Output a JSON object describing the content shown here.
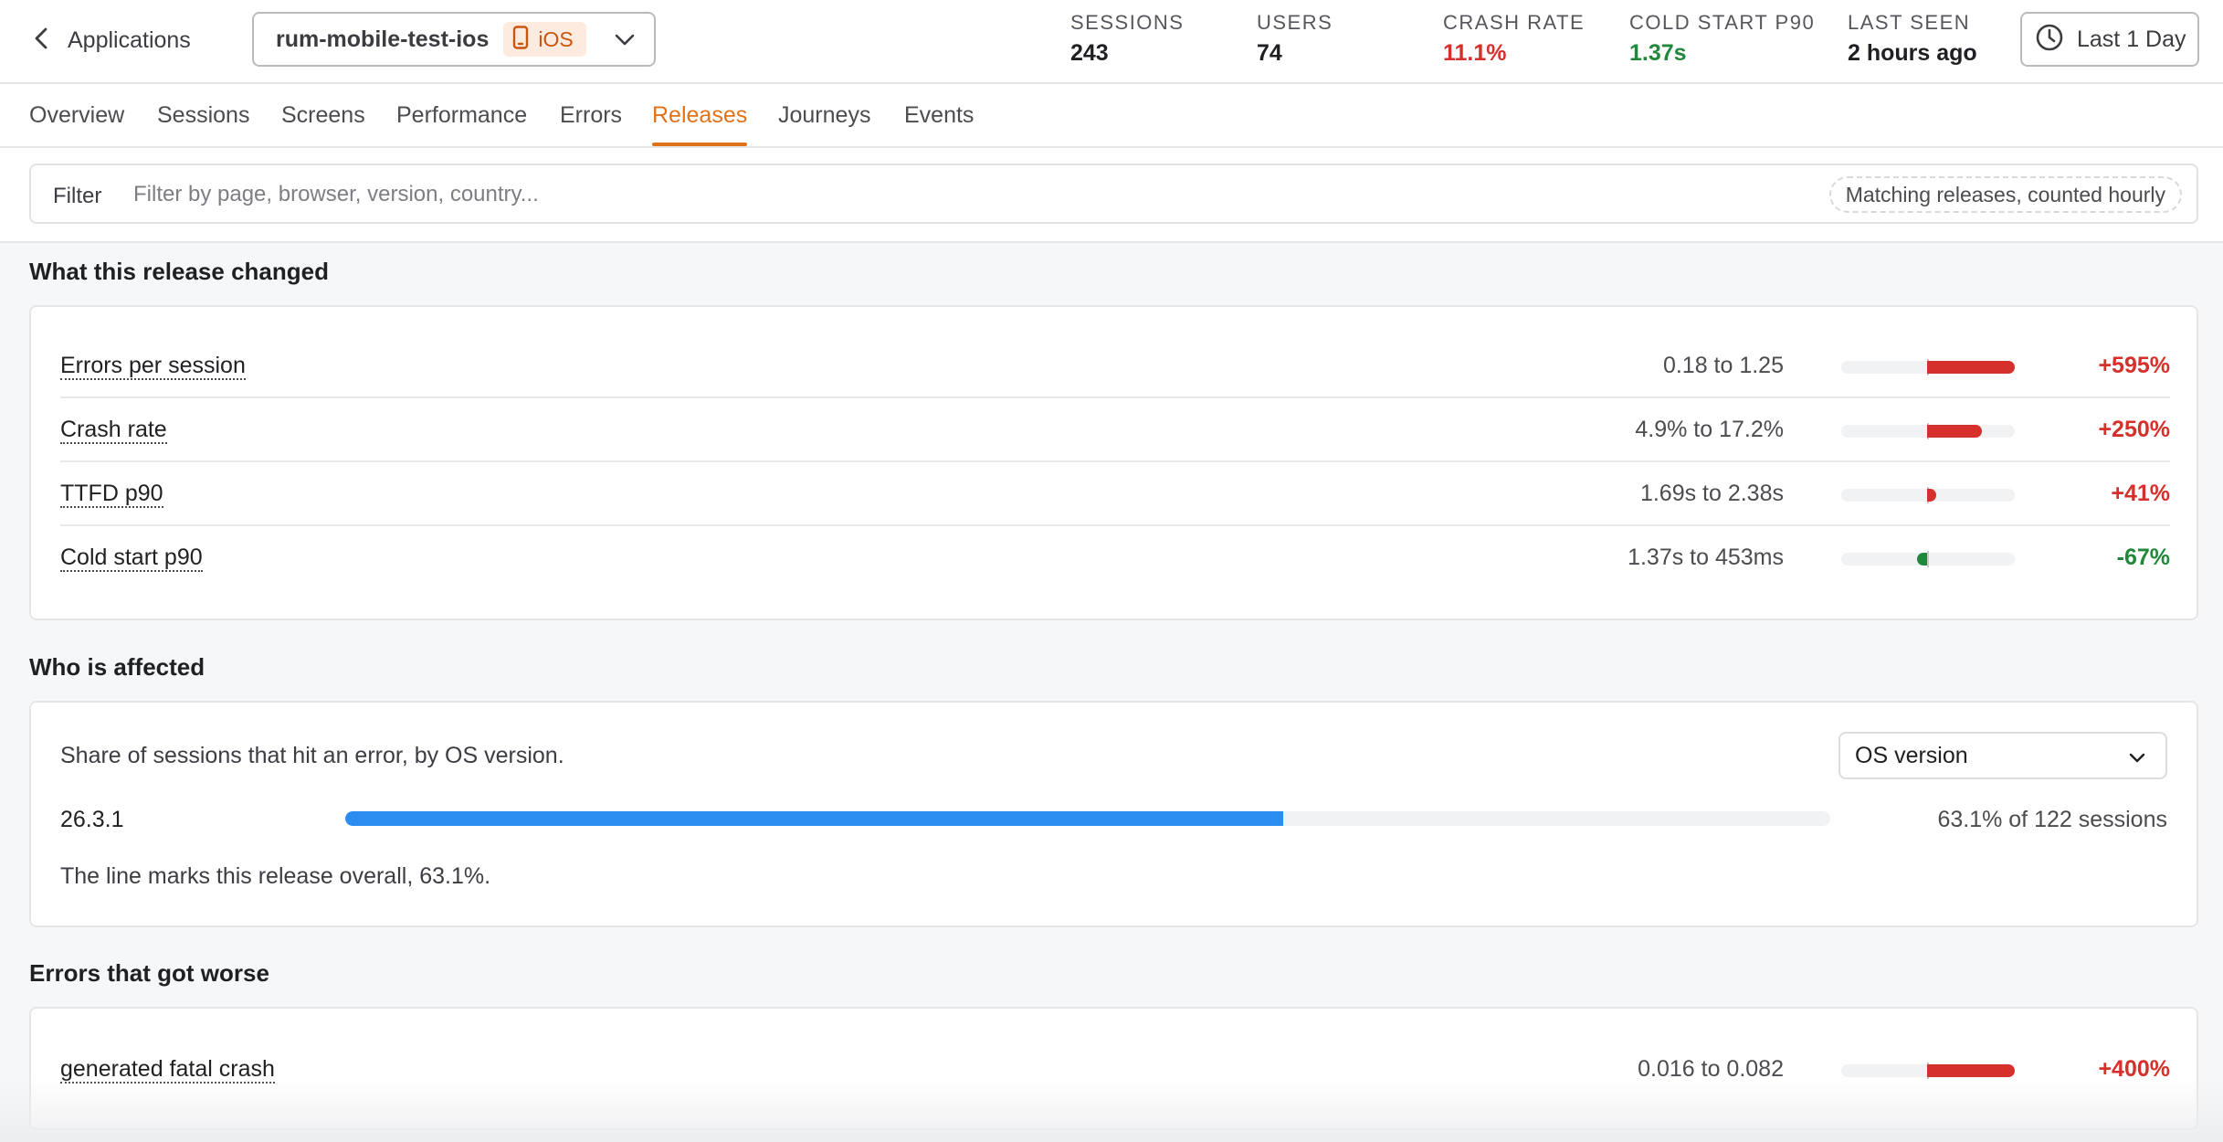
{
  "nav": {
    "back_label": "Applications"
  },
  "app": {
    "name": "rum-mobile-test-ios",
    "platform": "iOS"
  },
  "stats": [
    {
      "key": "SESSIONS",
      "value": "243",
      "tone": ""
    },
    {
      "key": "USERS",
      "value": "74",
      "tone": ""
    },
    {
      "key": "CRASH RATE",
      "value": "11.1%",
      "tone": "red"
    },
    {
      "key": "COLD START P90",
      "value": "1.37s",
      "tone": "green"
    },
    {
      "key": "LAST SEEN",
      "value": "2 hours ago",
      "tone": ""
    }
  ],
  "time_range": {
    "label": "Last 1 Day"
  },
  "tabs": [
    {
      "label": "Overview",
      "active": false
    },
    {
      "label": "Sessions",
      "active": false
    },
    {
      "label": "Screens",
      "active": false
    },
    {
      "label": "Performance",
      "active": false
    },
    {
      "label": "Errors",
      "active": false
    },
    {
      "label": "Releases",
      "active": true
    },
    {
      "label": "Journeys",
      "active": false
    },
    {
      "label": "Events",
      "active": false
    }
  ],
  "filter": {
    "label": "Filter",
    "placeholder": "Filter by page, browser, version, country...",
    "pill": "Matching releases, counted hourly"
  },
  "release_changes": {
    "title": "What this release changed",
    "metrics": [
      {
        "name": "Errors per session",
        "range": "0.18 to 1.25",
        "delta": "+595%",
        "change_pct": 595,
        "direction": "up"
      },
      {
        "name": "Crash rate",
        "range": "4.9% to 17.2%",
        "delta": "+250%",
        "change_pct": 250,
        "direction": "up"
      },
      {
        "name": "TTFD p90",
        "range": "1.69s to 2.38s",
        "delta": "+41%",
        "change_pct": 41,
        "direction": "up"
      },
      {
        "name": "Cold start p90",
        "range": "1.37s to 453ms",
        "delta": "-67%",
        "change_pct": -67,
        "direction": "down"
      }
    ]
  },
  "affected": {
    "title": "Who is affected",
    "description": "Share of sessions that hit an error, by OS version.",
    "group_by": "OS version",
    "rows": [
      {
        "os_version": "26.3.1",
        "share_pct": 63.1,
        "summary": "63.1% of 122 sessions"
      }
    ],
    "overall_pct": 63.1,
    "note": "The line marks this release overall, 63.1%."
  },
  "errors_worse": {
    "title": "Errors that got worse",
    "items": [
      {
        "name": "generated fatal crash",
        "range": "0.016 to 0.082",
        "delta": "+400%",
        "change_pct": 400,
        "direction": "up"
      }
    ]
  },
  "colors": {
    "accent": "#e0721a",
    "negative": "#d6302c",
    "positive": "#21873a",
    "bar": "#2b8def"
  }
}
